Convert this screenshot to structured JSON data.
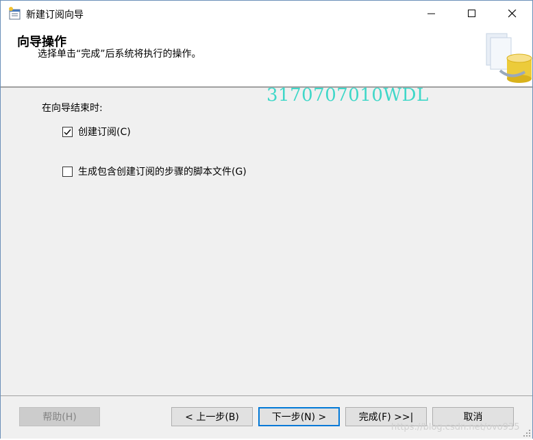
{
  "window": {
    "title": "新建订阅向导"
  },
  "header": {
    "title": "向导操作",
    "subtitle": "选择单击“完成”后系统将执行的操作。"
  },
  "body": {
    "watermark": "3170707010WDL",
    "section_label": "在向导结束时:",
    "options": [
      {
        "label": "创建订阅(C)",
        "checked": true
      },
      {
        "label": "生成包含创建订阅的步骤的脚本文件(G)",
        "checked": false
      }
    ]
  },
  "footer": {
    "help_label": "帮助(H)",
    "back_label": "< 上一步(B)",
    "next_label": "下一步(N) >",
    "finish_label": "完成(F) >>|",
    "cancel_label": "取消",
    "watermark": "https://blog.csdn.net/ovo935"
  },
  "icons": {
    "app": "wizard-app-icon",
    "minimize": "minimize-icon",
    "maximize": "maximize-icon",
    "close": "close-icon",
    "header_graphic": "database-graphic-icon",
    "checkmark": "checkmark-icon"
  },
  "colors": {
    "accent": "#0078d7",
    "watermark": "#3fd7c8",
    "disabled_text": "#838383"
  }
}
